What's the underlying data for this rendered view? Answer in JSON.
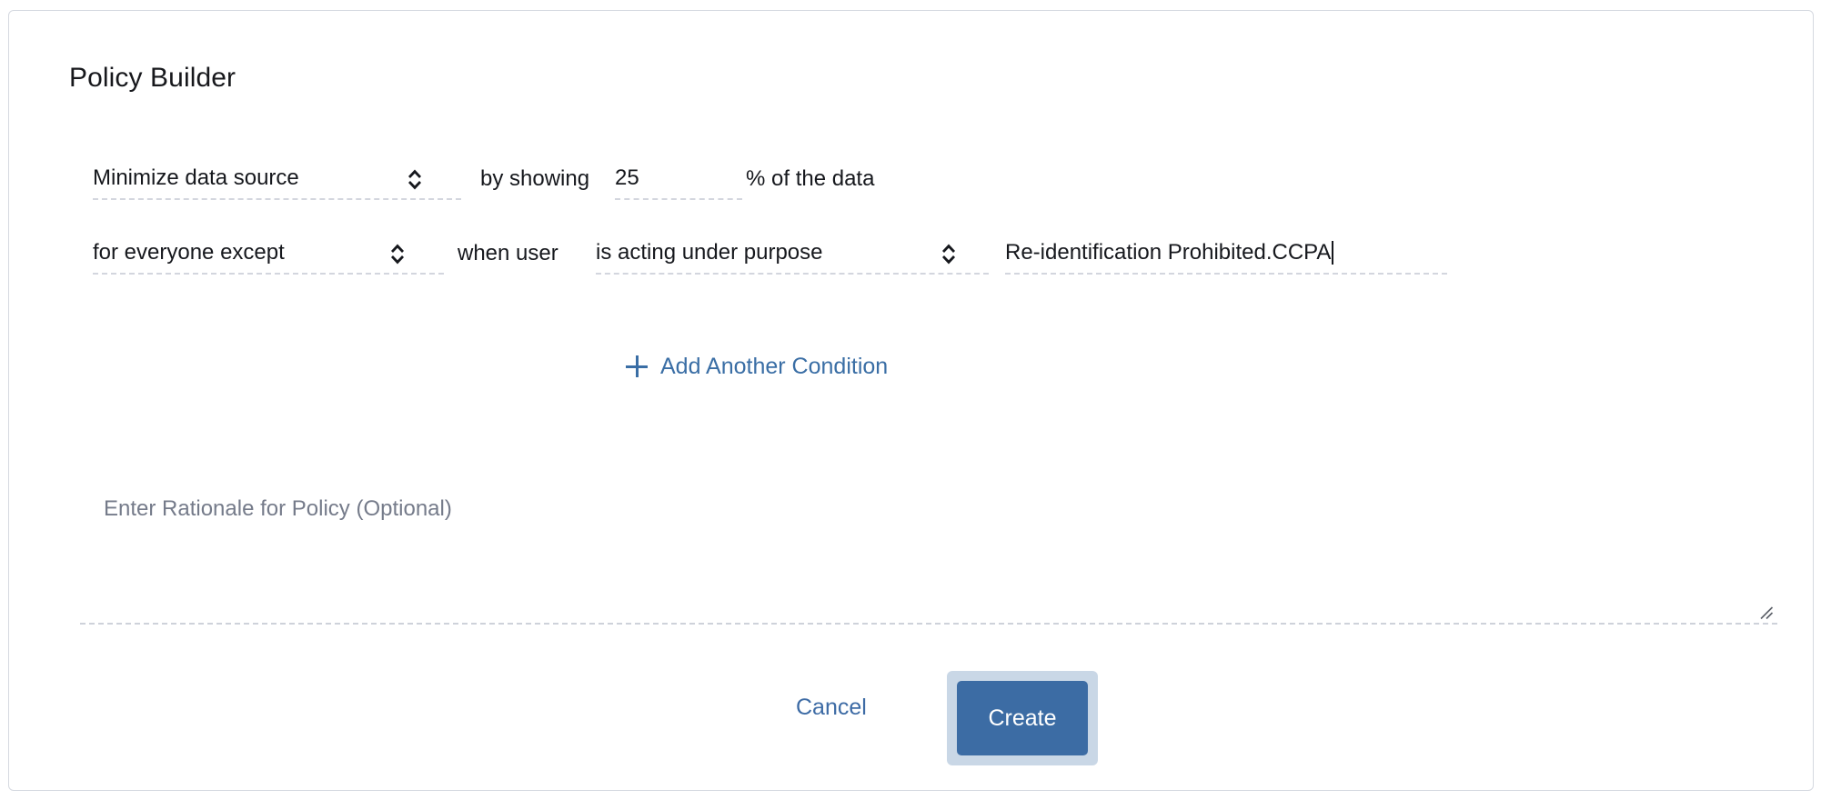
{
  "card": {
    "title": "Policy Builder"
  },
  "conditions": {
    "row1": {
      "action_select_value": "Minimize data source",
      "connector_text": "by showing",
      "amount_value": "25",
      "suffix_text": "% of the data"
    },
    "row2": {
      "scope_select_value": "for everyone except",
      "connector_text": "when user",
      "predicate_select_value": "is acting under purpose",
      "purpose_input_value": "Re-identification Prohibited.CCPA"
    }
  },
  "add_condition": {
    "icon": "plus-icon",
    "label": "Add Another Condition"
  },
  "rationale": {
    "placeholder": "Enter Rationale for Policy (Optional)",
    "value": "",
    "resize_icon": "resize-handle-icon"
  },
  "footer": {
    "cancel_label": "Cancel",
    "create_label": "Create"
  },
  "colors": {
    "accent_blue": "#3a6ea5",
    "primary_button": "#3c6ca4",
    "focus_ring": "#c9d7e6",
    "text": "#16181d",
    "placeholder": "#757b8a",
    "dashed_border": "#d3d6de",
    "card_border": "#d5d9e0"
  }
}
